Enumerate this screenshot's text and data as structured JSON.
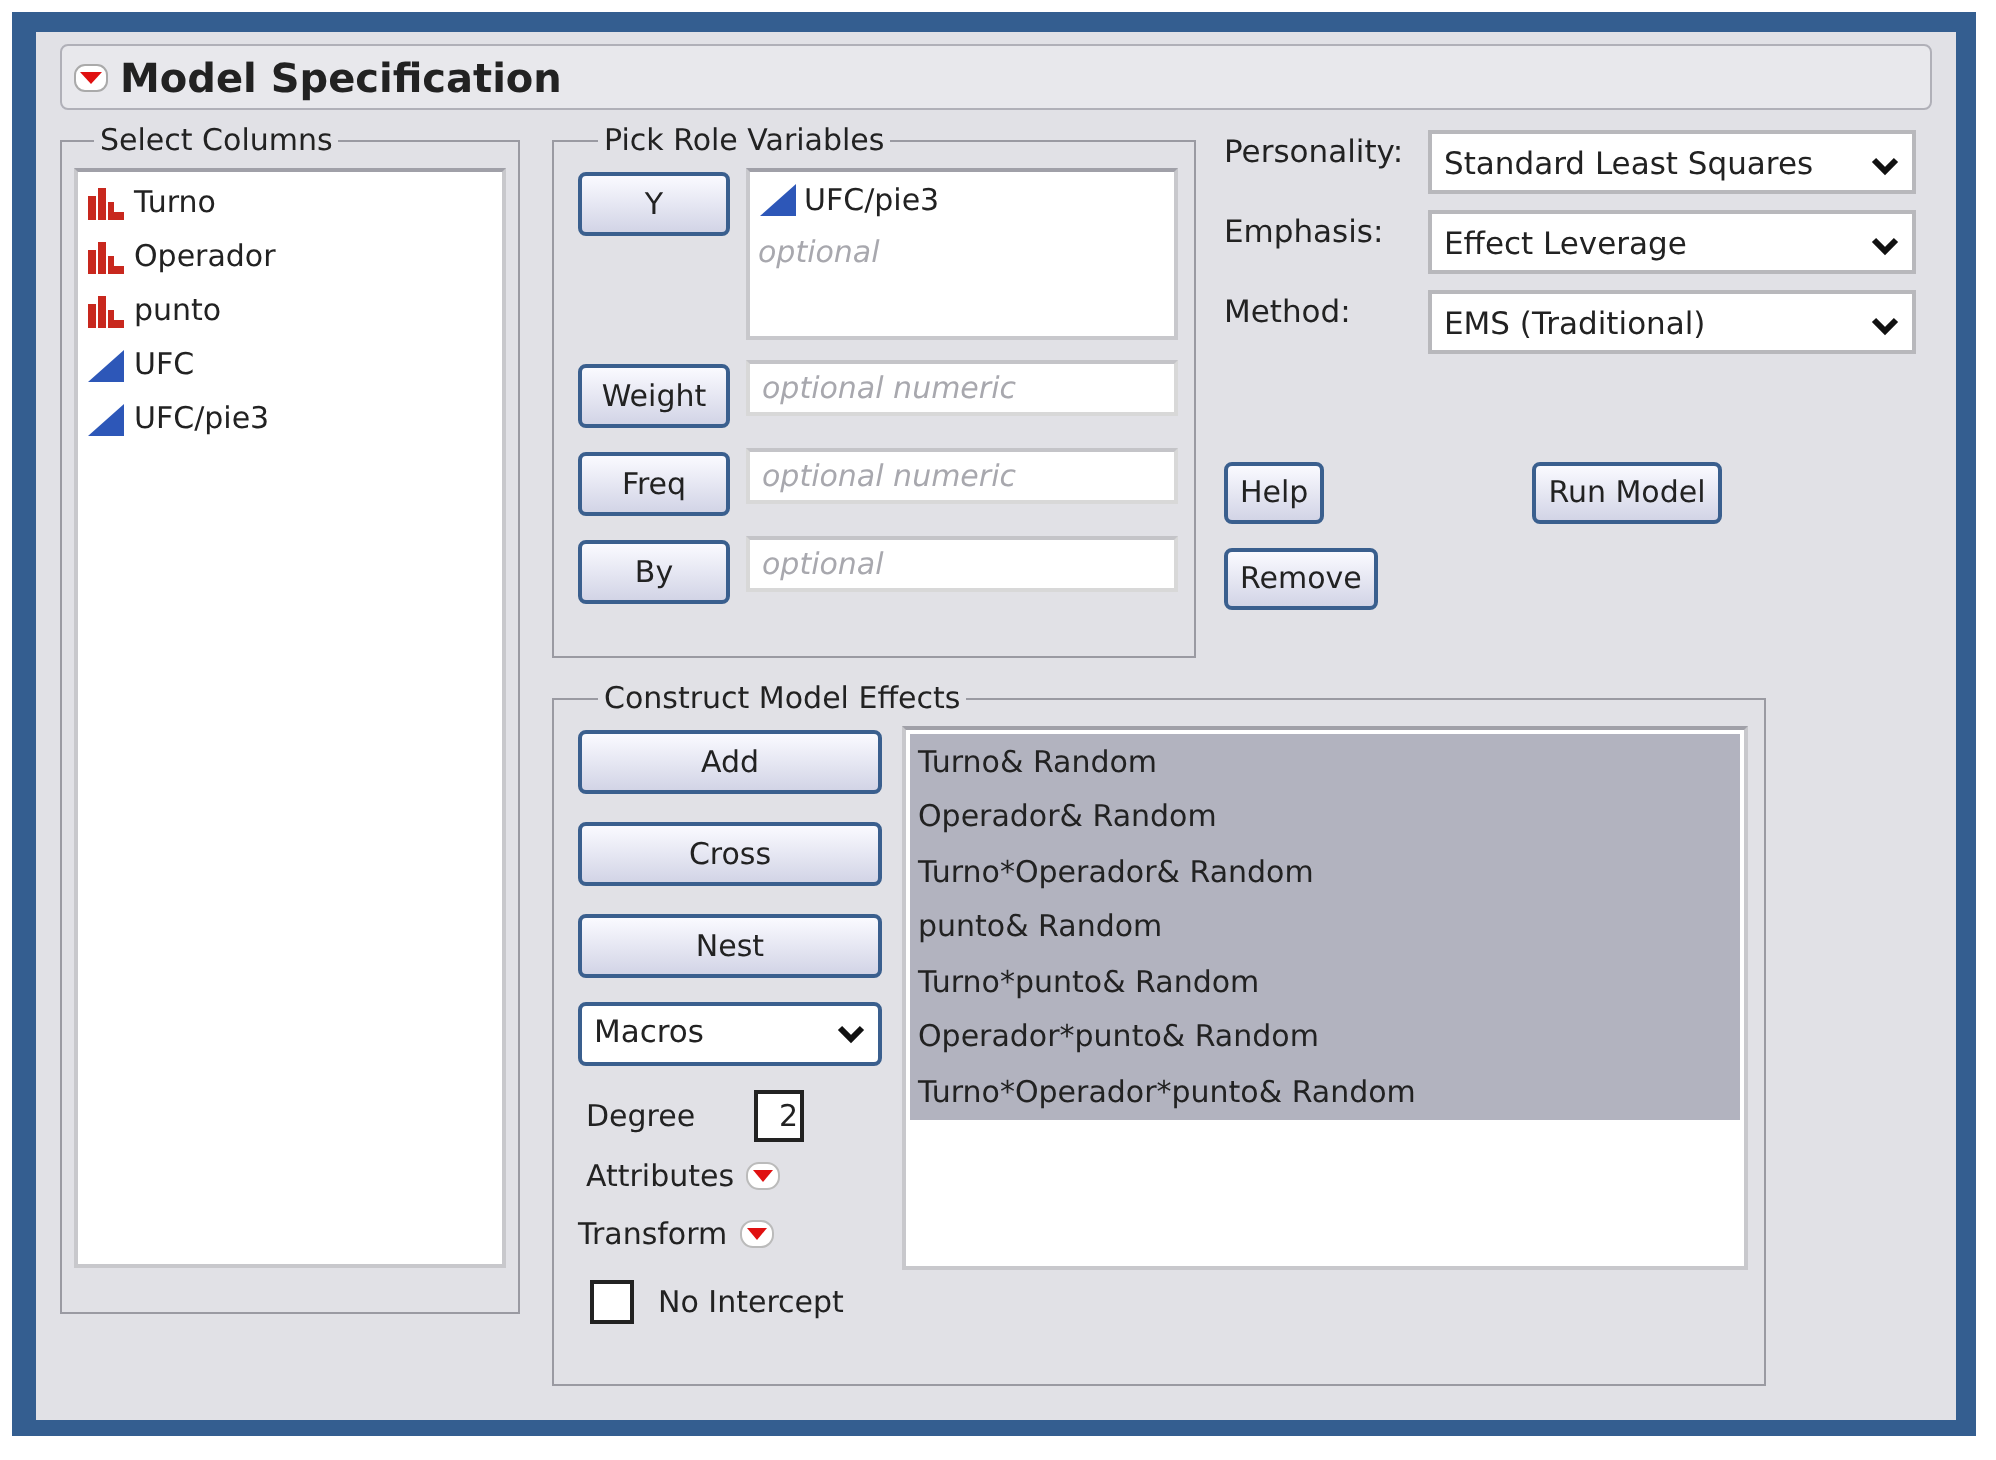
{
  "title": "Model Specification",
  "select_columns": {
    "legend": "Select Columns",
    "items": [
      {
        "label": "Turno",
        "kind": "nominal"
      },
      {
        "label": "Operador",
        "kind": "nominal"
      },
      {
        "label": "punto",
        "kind": "nominal"
      },
      {
        "label": "UFC",
        "kind": "continuous"
      },
      {
        "label": "UFC/pie3",
        "kind": "continuous"
      }
    ]
  },
  "pick_roles": {
    "legend": "Pick Role Variables",
    "roles": [
      {
        "button": "Y",
        "kind": "list",
        "items": [
          {
            "label": "UFC/pie3",
            "kind": "continuous"
          }
        ],
        "placeholder": "optional"
      },
      {
        "button": "Weight",
        "kind": "field",
        "placeholder": "optional numeric"
      },
      {
        "button": "Freq",
        "kind": "field",
        "placeholder": "optional numeric"
      },
      {
        "button": "By",
        "kind": "field",
        "placeholder": "optional"
      }
    ]
  },
  "settings": [
    {
      "label": "Personality:",
      "value": "Standard Least Squares"
    },
    {
      "label": "Emphasis:",
      "value": "Effect Leverage"
    },
    {
      "label": "Method:",
      "value": "EMS (Traditional)"
    }
  ],
  "actions": [
    [
      "Help",
      "Run Model"
    ],
    [
      "Remove"
    ]
  ],
  "effects": {
    "legend": "Construct Model Effects",
    "buttons": [
      "Add",
      "Cross",
      "Nest"
    ],
    "macros": "Macros",
    "degree_label": "Degree",
    "degree": "2",
    "menus": [
      "Attributes",
      "Transform"
    ],
    "no_intercept": {
      "label": "No Intercept",
      "checked": false
    },
    "items": [
      {
        "label": "Turno& Random",
        "selected": true
      },
      {
        "label": "Operador& Random",
        "selected": true
      },
      {
        "label": "Turno*Operador& Random",
        "selected": true
      },
      {
        "label": "punto& Random",
        "selected": true
      },
      {
        "label": "Turno*punto& Random",
        "selected": true
      },
      {
        "label": "Operador*punto& Random",
        "selected": true
      },
      {
        "label": "Turno*Operador*punto& Random",
        "selected": true
      }
    ]
  }
}
